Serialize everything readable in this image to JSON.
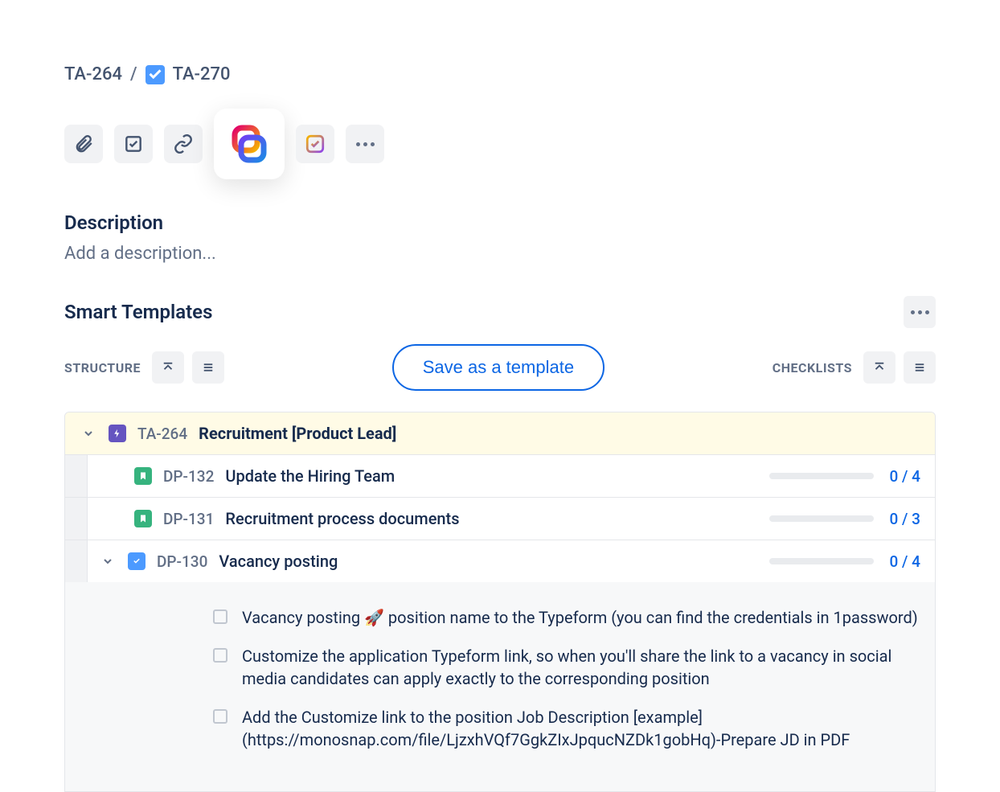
{
  "breadcrumb": {
    "parent": "TA-264",
    "current": "TA-270"
  },
  "description": {
    "heading": "Description",
    "placeholder": "Add a description..."
  },
  "smartTemplates": {
    "title": "Smart Templates",
    "structureLabel": "STRUCTURE",
    "checklistsLabel": "CHECKLISTS",
    "saveButton": "Save as a template"
  },
  "tree": {
    "parent": {
      "key": "TA-264",
      "title": "Recruitment [Product Lead]"
    },
    "children": [
      {
        "key": "DP-132",
        "title": "Update the Hiring Team",
        "progress": "0 / 4",
        "type": "story"
      },
      {
        "key": "DP-131",
        "title": "Recruitment process documents",
        "progress": "0 / 3",
        "type": "story"
      },
      {
        "key": "DP-130",
        "title": "Vacancy posting",
        "progress": "0 / 4",
        "type": "task"
      }
    ]
  },
  "checklist": [
    "Vacancy posting 🚀 position name to the Typeform (you can find the credentials in 1password)",
    "Customize the application Typeform link, so when you'll share the link to a vacancy in social media candidates can apply exactly to the corresponding position",
    "Add the Customize link to the position Job Description [example] (https://monosnap.com/file/LjzxhVQf7GgkZIxJpqucNZDk1gobHq)-Prepare JD in PDF"
  ]
}
